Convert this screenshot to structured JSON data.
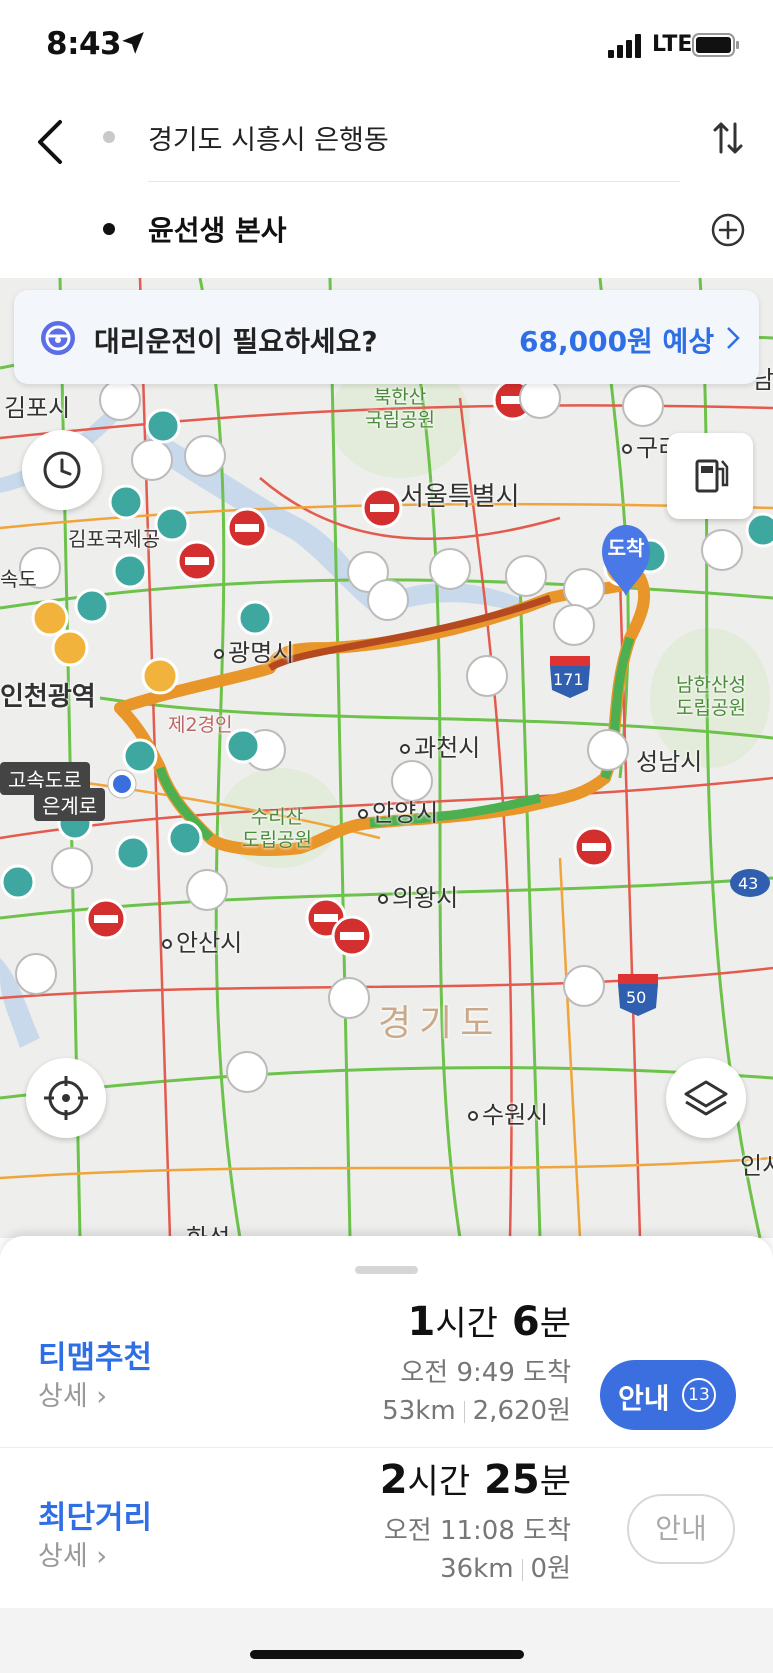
{
  "status_bar": {
    "time": "8:43",
    "network": "LTE"
  },
  "search": {
    "origin": "경기도 시흥시 은행동",
    "destination": "윤선생 본사"
  },
  "driver_banner": {
    "text": "대리운전이 필요하세요?",
    "price": "68,000원 예상"
  },
  "map": {
    "dest_pin_label": "도착",
    "labels": {
      "gimpo": "김포시",
      "gimpo_airport": "김포국제공",
      "gwangmyeong": "광명시",
      "seoul": "서울특별시",
      "bukhansan": "북한산\n국립공원",
      "guri": "구리",
      "namhansanseong": "남한산성\n도립공원",
      "gwacheon": "과천시",
      "seongnam": "성남시",
      "anyang": "안양시",
      "suri": "수리산\n도립공원",
      "uiwang": "의왕시",
      "ansan": "안산시",
      "gyeonggi": "경기도",
      "suwon": "수원시",
      "incheon": "인천광역",
      "second_gyeongin": "제2경인",
      "highway_label": "고속도로",
      "eungye": "은계로",
      "hwaseong": "화성",
      "inchi": "인시",
      "nam": "남",
      "gimpo_highway": "속도"
    },
    "route_shields": [
      "171",
      "50",
      "43"
    ]
  },
  "routes": [
    {
      "name": "티맵추천",
      "detail": "상세",
      "hours": "1",
      "hours_unit": "시간",
      "minutes": "6",
      "minutes_unit": "분",
      "arrival": "오전 9:49 도착",
      "distance": "53km",
      "toll": "2,620원",
      "button": "안내",
      "badge": "13"
    },
    {
      "name": "최단거리",
      "detail": "상세",
      "hours": "2",
      "hours_unit": "시간",
      "minutes": "25",
      "minutes_unit": "분",
      "arrival": "오전 11:08 도착",
      "distance": "36km",
      "toll": "0원",
      "button": "안내"
    }
  ],
  "colors": {
    "accent": "#3b6fe0",
    "route_orange": "#e8962a",
    "route_green": "#4caf50",
    "route_red": "#c62828",
    "pin_teal": "#3ea7a0",
    "pin_blue": "#5b8def"
  }
}
